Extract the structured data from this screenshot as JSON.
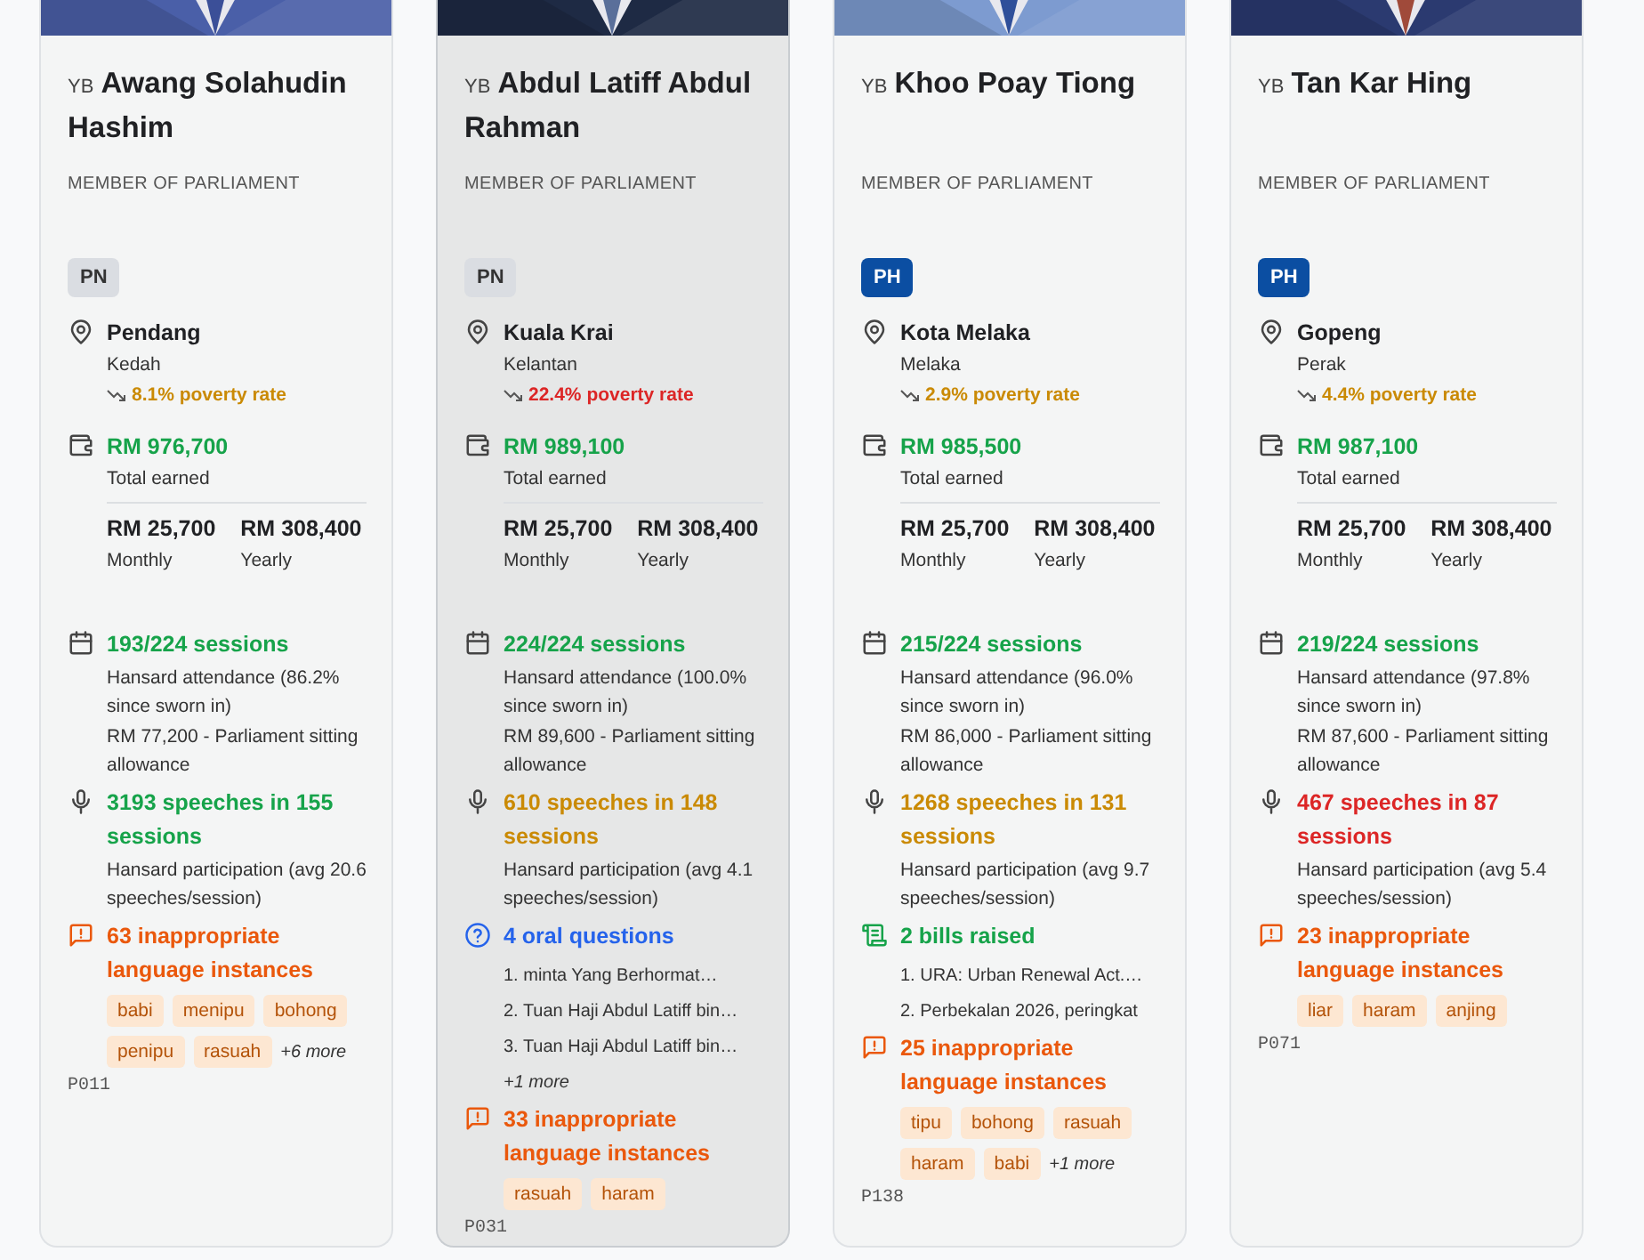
{
  "cards": [
    {
      "title": "YB",
      "name": "Awang Solahudin Hashim",
      "role": "MEMBER OF PARLIAMENT",
      "party": {
        "label": "PN",
        "kind": "pn"
      },
      "highlighted": false,
      "seat": "Pendang",
      "state": "Kedah",
      "poverty": {
        "text": "8.1% poverty rate",
        "color": "#ca8a04"
      },
      "earned": "RM 976,700",
      "earned_label": "Total earned",
      "monthly": "RM 25,700",
      "monthly_label": "Monthly",
      "yearly": "RM 308,400",
      "yearly_label": "Yearly",
      "stats": [
        {
          "kind": "attendance",
          "color": "#16a34a",
          "headline": "193/224 sessions",
          "lines": [
            "Hansard attendance (86.2% since sworn in)",
            "RM 77,200 - Parliament sitting allowance"
          ]
        },
        {
          "kind": "speeches",
          "color": "#16a34a",
          "headline": "3193 speeches in 155 sessions",
          "lines": [
            "Hansard participation (avg 20.6 speeches/session)"
          ]
        },
        {
          "kind": "language",
          "color": "#ea580c",
          "headline": "63 inappropriate language instances",
          "tags": [
            "babi",
            "menipu",
            "bohong",
            "penipu",
            "rasuah"
          ],
          "more": "+6 more"
        }
      ],
      "code": "P011"
    },
    {
      "title": "YB",
      "name": "Abdul Latiff Abdul Rahman",
      "role": "MEMBER OF PARLIAMENT",
      "party": {
        "label": "PN",
        "kind": "pn"
      },
      "highlighted": true,
      "seat": "Kuala Krai",
      "state": "Kelantan",
      "poverty": {
        "text": "22.4% poverty rate",
        "color": "#dc2626"
      },
      "earned": "RM 989,100",
      "earned_label": "Total earned",
      "monthly": "RM 25,700",
      "monthly_label": "Monthly",
      "yearly": "RM 308,400",
      "yearly_label": "Yearly",
      "stats": [
        {
          "kind": "attendance",
          "color": "#16a34a",
          "headline": "224/224 sessions",
          "lines": [
            "Hansard attendance (100.0% since sworn in)",
            "RM 89,600 - Parliament sitting allowance"
          ]
        },
        {
          "kind": "speeches",
          "color": "#ca8a04",
          "headline": "610 speeches in 148 sessions",
          "lines": [
            "Hansard participation (avg 4.1 speeches/session)"
          ]
        },
        {
          "kind": "questions",
          "color": "#2563eb",
          "headline": "4 oral questions",
          "items": [
            "1. minta Yang Berhormat…",
            "2. Tuan Haji Abdul Latiff bin…",
            "3. Tuan Haji Abdul Latiff bin…"
          ],
          "more": "+1 more"
        },
        {
          "kind": "language",
          "color": "#ea580c",
          "headline": "33 inappropriate language instances",
          "tags": [
            "rasuah",
            "haram"
          ]
        }
      ],
      "code": "P031"
    },
    {
      "title": "YB",
      "name": "Khoo Poay Tiong",
      "role": "MEMBER OF PARLIAMENT",
      "party": {
        "label": "PH",
        "kind": "ph"
      },
      "highlighted": false,
      "seat": "Kota Melaka",
      "state": "Melaka",
      "poverty": {
        "text": "2.9% poverty rate",
        "color": "#ca8a04"
      },
      "earned": "RM 985,500",
      "earned_label": "Total earned",
      "monthly": "RM 25,700",
      "monthly_label": "Monthly",
      "yearly": "RM 308,400",
      "yearly_label": "Yearly",
      "stats": [
        {
          "kind": "attendance",
          "color": "#16a34a",
          "headline": "215/224 sessions",
          "lines": [
            "Hansard attendance (96.0% since sworn in)",
            "RM 86,000 - Parliament sitting allowance"
          ]
        },
        {
          "kind": "speeches",
          "color": "#ca8a04",
          "headline": "1268 speeches in 131 sessions",
          "lines": [
            "Hansard participation (avg 9.7 speeches/session)"
          ]
        },
        {
          "kind": "bills",
          "color": "#16a34a",
          "headline": "2 bills raised",
          "items": [
            "1. URA: Urban Renewal Act.…",
            "2. Perbekalan 2026, peringkat"
          ]
        },
        {
          "kind": "language",
          "color": "#ea580c",
          "headline": "25 inappropriate language instances",
          "tags": [
            "tipu",
            "bohong",
            "rasuah",
            "haram",
            "babi"
          ],
          "more": "+1 more"
        }
      ],
      "code": "P138"
    },
    {
      "title": "YB",
      "name": "Tan Kar Hing",
      "role": "MEMBER OF PARLIAMENT",
      "party": {
        "label": "PH",
        "kind": "ph"
      },
      "highlighted": false,
      "seat": "Gopeng",
      "state": "Perak",
      "poverty": {
        "text": "4.4% poverty rate",
        "color": "#ca8a04"
      },
      "earned": "RM 987,100",
      "earned_label": "Total earned",
      "monthly": "RM 25,700",
      "monthly_label": "Monthly",
      "yearly": "RM 308,400",
      "yearly_label": "Yearly",
      "stats": [
        {
          "kind": "attendance",
          "color": "#16a34a",
          "headline": "219/224 sessions",
          "lines": [
            "Hansard attendance (97.8% since sworn in)",
            "RM 87,600 - Parliament sitting allowance"
          ]
        },
        {
          "kind": "speeches",
          "color": "#dc2626",
          "headline": "467 speeches in 87 sessions",
          "lines": [
            "Hansard participation (avg 5.4 speeches/session)"
          ]
        },
        {
          "kind": "language",
          "color": "#ea580c",
          "headline": "23 inappropriate language instances",
          "tags": [
            "liar",
            "haram",
            "anjing"
          ]
        }
      ],
      "code": "P071"
    }
  ]
}
